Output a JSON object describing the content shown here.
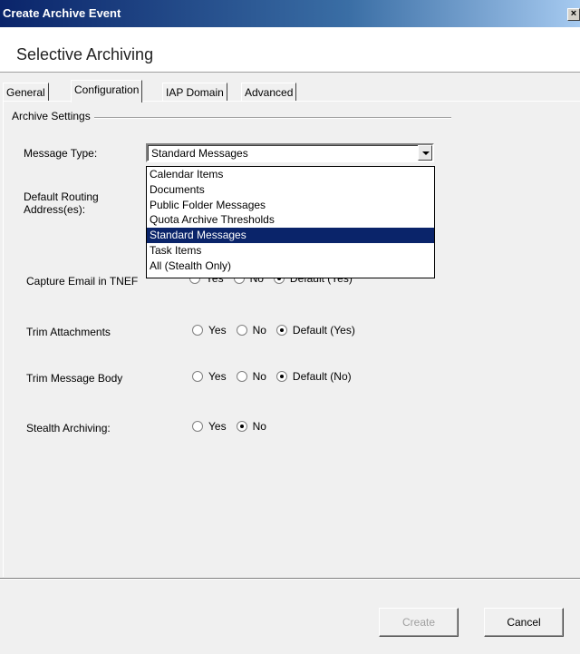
{
  "window": {
    "title": "Create Archive Event",
    "close_glyph": "×"
  },
  "header": {
    "heading": "Selective Archiving"
  },
  "tabs": [
    {
      "label": "General"
    },
    {
      "label": "Configuration"
    },
    {
      "label": "IAP Domain"
    },
    {
      "label": "Advanced"
    }
  ],
  "archive_settings": {
    "group_label": "Archive Settings",
    "message_type_label": "Message Type:",
    "message_type_value": "Standard Messages",
    "message_type_options": [
      "Calendar Items",
      "Documents",
      "Public Folder Messages",
      "Quota Archive Thresholds",
      "Standard Messages",
      "Task Items",
      "All (Stealth Only)"
    ],
    "default_routing_label_1": "Default Routing",
    "default_routing_label_2": "Address(es):",
    "capture_tnef": {
      "label": "Capture Email in TNEF",
      "yes": "Yes",
      "no": "No",
      "default": "Default (Yes)",
      "selected": "default"
    },
    "trim_attachments": {
      "label": "Trim Attachments",
      "yes": "Yes",
      "no": "No",
      "default": "Default (Yes)",
      "selected": "default"
    },
    "trim_message_body": {
      "label": "Trim Message Body",
      "yes": "Yes",
      "no": "No",
      "default": "Default (No)",
      "selected": "default"
    },
    "stealth_archiving": {
      "label": "Stealth Archiving:",
      "yes": "Yes",
      "no": "No",
      "selected": "no"
    }
  },
  "footer": {
    "create_label": "Create",
    "cancel_label": "Cancel"
  }
}
